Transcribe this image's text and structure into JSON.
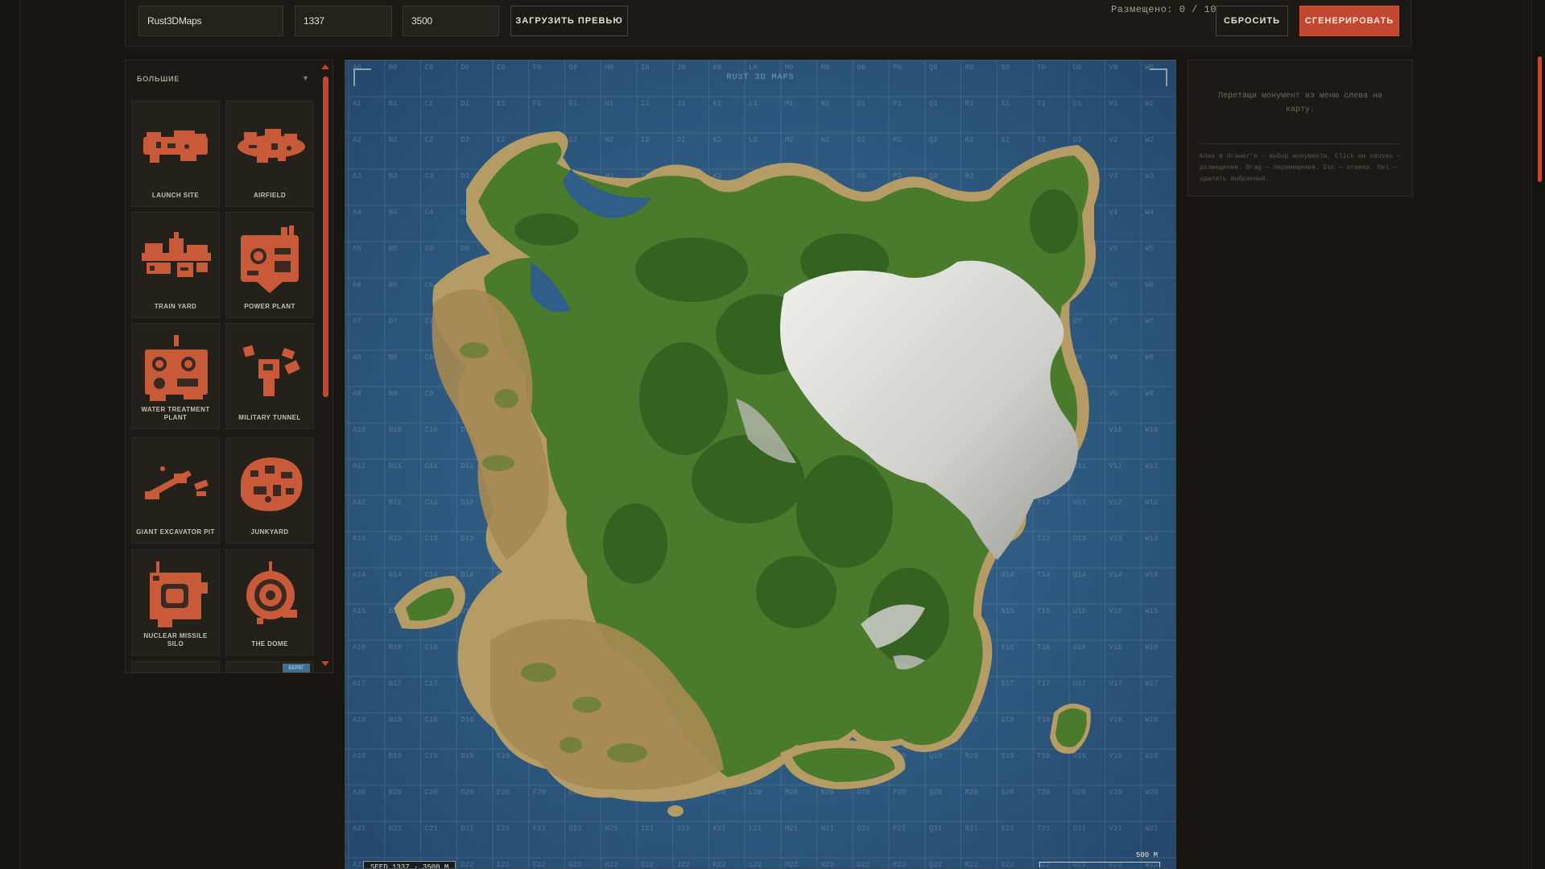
{
  "toolbar": {
    "map_name": "Rust3DMaps",
    "seed": "1337",
    "size": "3500",
    "load_preview_label": "ЗАГРУЗИТЬ ПРЕВЬЮ",
    "placed_label": "Размещено: 0 / 10",
    "reset_label": "СБРОСИТЬ",
    "generate_label": "СГЕНЕРИРОВАТЬ"
  },
  "sidebar": {
    "category": "БОЛЬШИЕ",
    "monuments": [
      {
        "label": "LAUNCH SITE"
      },
      {
        "label": "AIRFIELD"
      },
      {
        "label": "TRAIN YARD"
      },
      {
        "label": "POWER PLANT"
      },
      {
        "label": "WATER TREATMENT PLANT"
      },
      {
        "label": "MILITARY TUNNEL"
      },
      {
        "label": "GIANT EXCAVATOR PIT"
      },
      {
        "label": "JUNKYARD"
      },
      {
        "label": "NUCLEAR MISSILE SILO"
      },
      {
        "label": "THE DOME"
      }
    ],
    "partial_badge": "БЕРЕГ"
  },
  "map": {
    "title": "RUST 3D MAPS",
    "seed_readout": "SEED 1337 · 3500 M",
    "scale_label": "500 M",
    "grid_columns": [
      "A",
      "B",
      "C",
      "D",
      "E",
      "F",
      "G",
      "H",
      "I",
      "J",
      "K",
      "L",
      "M",
      "N",
      "O",
      "P",
      "Q",
      "R",
      "S",
      "T",
      "U",
      "V",
      "W"
    ],
    "grid_rows": 22
  },
  "right_panel": {
    "hint": "Перетащи монумент из меню слева на карту.",
    "help": "Клик в drawer'е — выбор монумента. Click на canvas — размещение. Drag — перемещение. Esc — отмена. Del — удалить выбранный."
  },
  "colors": {
    "accent": "#c2472e",
    "ocean": "#2c5a83",
    "grass": "#4a7a2c",
    "sand": "#b59c64",
    "snow": "#d9d9d6",
    "icon": "#c85a3a"
  }
}
